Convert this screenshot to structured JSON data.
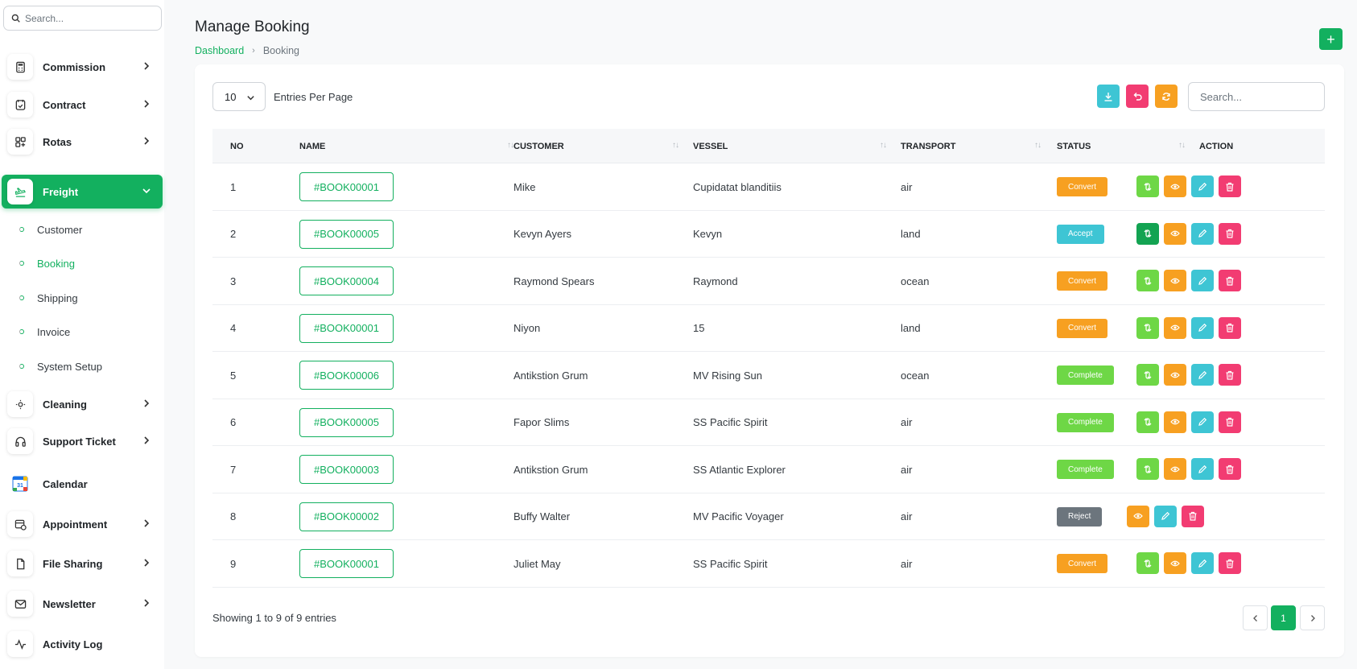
{
  "sidebar": {
    "search_placeholder": "Search...",
    "items_top": [
      {
        "label": "Commission",
        "icon": "calculator-icon"
      },
      {
        "label": "Contract",
        "icon": "contract-icon"
      },
      {
        "label": "Rotas",
        "icon": "grid-icon"
      },
      {
        "label": "Freight",
        "icon": "plane-icon"
      }
    ],
    "freight_sub": [
      "Customer",
      "Booking",
      "Shipping",
      "Invoice",
      "System Setup"
    ],
    "items_bottom": [
      {
        "label": "Cleaning",
        "icon": "sun-icon"
      },
      {
        "label": "Support Ticket",
        "icon": "headphones-icon"
      },
      {
        "label": "Calendar",
        "icon": "calendar-color-icon"
      },
      {
        "label": "Appointment",
        "icon": "calendar-clock-icon"
      },
      {
        "label": "File Sharing",
        "icon": "file-icon"
      },
      {
        "label": "Newsletter",
        "icon": "mail-icon"
      },
      {
        "label": "Activity Log",
        "icon": "activity-icon"
      }
    ],
    "calendar_day": "31"
  },
  "header": {
    "title": "Manage Booking",
    "breadcrumb_home": "Dashboard",
    "breadcrumb_current": "Booking",
    "add_label": "+"
  },
  "toolbar": {
    "entries_value": "10",
    "entries_label": "Entries Per Page",
    "search_placeholder": "Search..."
  },
  "table": {
    "columns": [
      "NO",
      "NAME",
      "CUSTOMER",
      "VESSEL",
      "TRANSPORT",
      "STATUS",
      "ACTION"
    ],
    "sort_glyph": "↑↓",
    "rows": [
      {
        "no": "1",
        "name": "#BOOK00001",
        "customer": "Mike",
        "vessel": "Cupidatat blanditiis",
        "transport": "air",
        "status": "Convert",
        "convert_variant": "light"
      },
      {
        "no": "2",
        "name": "#BOOK00005",
        "customer": "Kevyn Ayers",
        "vessel": "Kevyn",
        "transport": "land",
        "status": "Accept",
        "convert_variant": "dark"
      },
      {
        "no": "3",
        "name": "#BOOK00004",
        "customer": "Raymond Spears",
        "vessel": "Raymond",
        "transport": "ocean",
        "status": "Convert",
        "convert_variant": "light"
      },
      {
        "no": "4",
        "name": "#BOOK00001",
        "customer": "Niyon",
        "vessel": "15",
        "transport": "land",
        "status": "Convert",
        "convert_variant": "light"
      },
      {
        "no": "5",
        "name": "#BOOK00006",
        "customer": "Antikstion Grum",
        "vessel": "MV Rising Sun",
        "transport": "ocean",
        "status": "Complete",
        "convert_variant": "light"
      },
      {
        "no": "6",
        "name": "#BOOK00005",
        "customer": "Fapor Slims",
        "vessel": "SS Pacific Spirit",
        "transport": "air",
        "status": "Complete",
        "convert_variant": "light"
      },
      {
        "no": "7",
        "name": "#BOOK00003",
        "customer": "Antikstion Grum",
        "vessel": "SS Atlantic Explorer",
        "transport": "air",
        "status": "Complete",
        "convert_variant": "light"
      },
      {
        "no": "8",
        "name": "#BOOK00002",
        "customer": "Buffy Walter",
        "vessel": "MV Pacific Voyager",
        "transport": "air",
        "status": "Reject",
        "convert_variant": "none"
      },
      {
        "no": "9",
        "name": "#BOOK00001",
        "customer": "Juliet May",
        "vessel": "SS Pacific Spirit",
        "transport": "air",
        "status": "Convert",
        "convert_variant": "light"
      }
    ]
  },
  "status_colors": {
    "Convert": "#f7a021",
    "Accept": "#3ec5d4",
    "Complete": "#6ed746",
    "Reject": "#6c757d"
  },
  "action_colors": {
    "convert_light": "#6ed746",
    "convert_dark": "#13a352",
    "view": "#f7a021",
    "edit": "#3ec5d4",
    "delete": "#f23c72"
  },
  "footer": {
    "showing": "Showing 1 to 9 of 9 entries",
    "current_page": "1"
  },
  "accent": "#13b05f"
}
